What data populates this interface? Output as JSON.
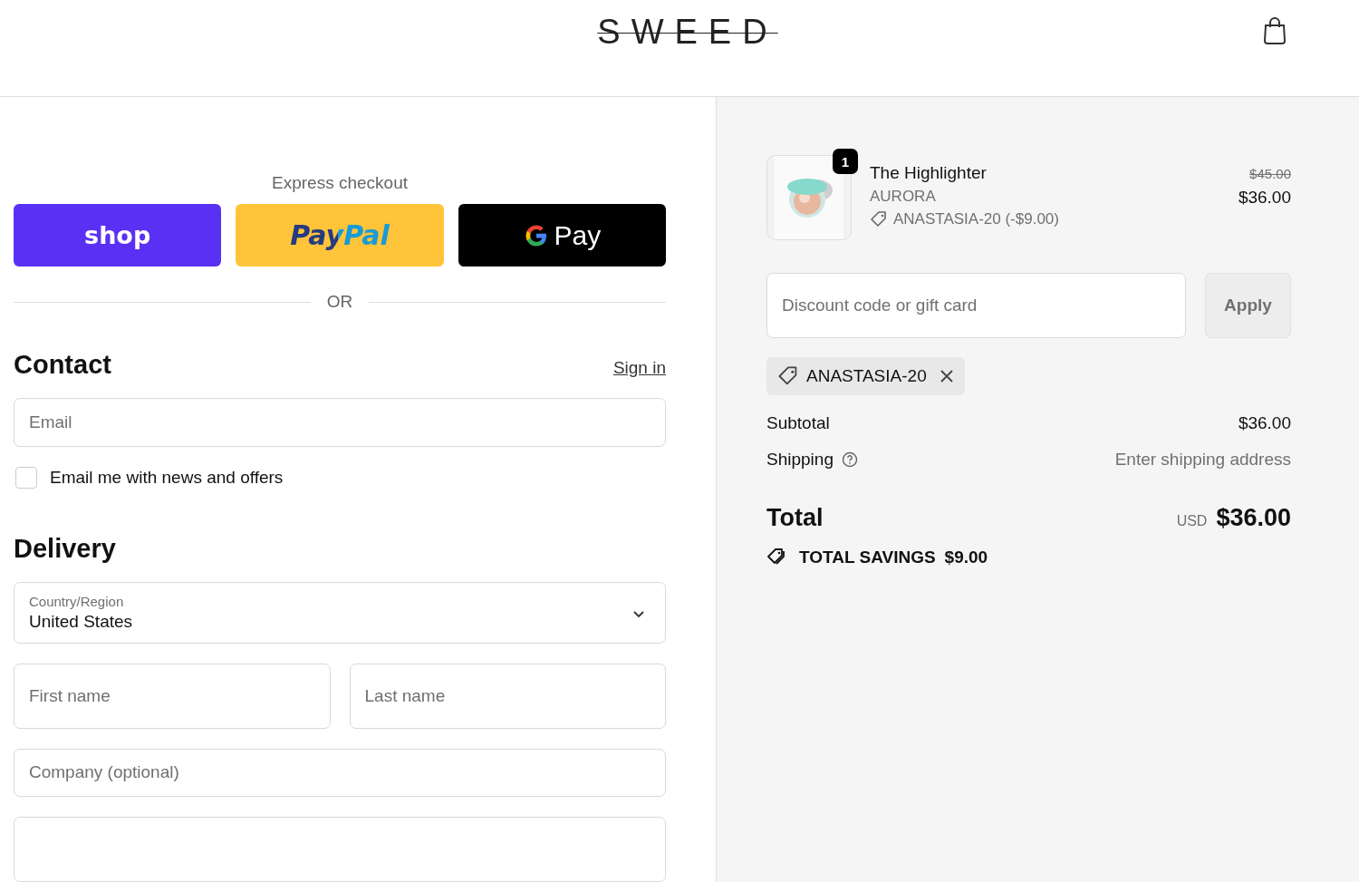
{
  "header": {
    "logo": "SWEED"
  },
  "express": {
    "title": "Express checkout",
    "buttons": [
      {
        "kind": "shop",
        "label": "shop"
      },
      {
        "kind": "paypal",
        "label": "PayPal"
      },
      {
        "kind": "gpay",
        "label": "Pay"
      }
    ],
    "divider": "OR"
  },
  "contact": {
    "title": "Contact",
    "sign_in": "Sign in",
    "email": {
      "placeholder": "Email"
    },
    "newsletter": {
      "label": "Email me with news and offers",
      "checked": false
    }
  },
  "delivery": {
    "title": "Delivery",
    "country": {
      "label": "Country/Region",
      "value": "United States"
    },
    "first_name": {
      "placeholder": "First name"
    },
    "last_name": {
      "placeholder": "Last name"
    },
    "company": {
      "placeholder": "Company (optional)"
    }
  },
  "cart": {
    "items": [
      {
        "quantity": "1",
        "name": "The Highlighter",
        "variant": "AURORA",
        "discount": "ANASTASIA-20 (-$9.00)",
        "original_price": "$45.00",
        "price": "$36.00"
      }
    ],
    "discount_field": {
      "placeholder": "Discount code or gift card"
    },
    "apply_button": {
      "label": "Apply",
      "disabled": true
    },
    "applied_codes": [
      "ANASTASIA-20"
    ],
    "subtotal": {
      "label": "Subtotal",
      "value": "$36.00"
    },
    "shipping": {
      "label": "Shipping",
      "value": "Enter shipping address"
    },
    "total": {
      "label": "Total",
      "currency": "USD",
      "value": "$36.00"
    },
    "savings": {
      "label": "TOTAL SAVINGS",
      "value": "$9.00"
    }
  }
}
